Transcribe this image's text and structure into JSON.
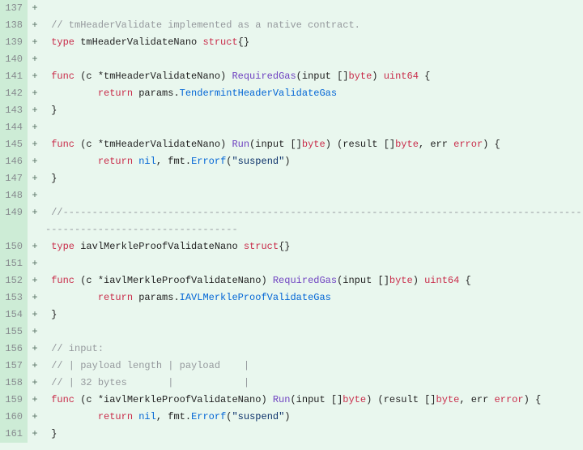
{
  "diff": {
    "lines": [
      {
        "n": "137",
        "s": "+",
        "tokens": []
      },
      {
        "n": "138",
        "s": "+",
        "tokens": [
          {
            "t": " ",
            "c": null
          },
          {
            "t": "// tmHeaderValidate implemented as a native contract.",
            "c": "cm"
          }
        ]
      },
      {
        "n": "139",
        "s": "+",
        "tokens": [
          {
            "t": " ",
            "c": null
          },
          {
            "t": "type",
            "c": "kw"
          },
          {
            "t": " tmHeaderValidateNano ",
            "c": null
          },
          {
            "t": "struct",
            "c": "kw"
          },
          {
            "t": "{}",
            "c": null
          }
        ]
      },
      {
        "n": "140",
        "s": "+",
        "tokens": []
      },
      {
        "n": "141",
        "s": "+",
        "tokens": [
          {
            "t": " ",
            "c": null
          },
          {
            "t": "func",
            "c": "kw"
          },
          {
            "t": " (c *tmHeaderValidateNano) ",
            "c": null
          },
          {
            "t": "RequiredGas",
            "c": "fn"
          },
          {
            "t": "(input []",
            "c": null
          },
          {
            "t": "byte",
            "c": "ty"
          },
          {
            "t": ") ",
            "c": null
          },
          {
            "t": "uint64",
            "c": "ty"
          },
          {
            "t": " {",
            "c": null
          }
        ]
      },
      {
        "n": "142",
        "s": "+",
        "tokens": [
          {
            "t": "         ",
            "c": null
          },
          {
            "t": "return",
            "c": "kw"
          },
          {
            "t": " params.",
            "c": null
          },
          {
            "t": "TendermintHeaderValidateGas",
            "c": "cl"
          }
        ]
      },
      {
        "n": "143",
        "s": "+",
        "tokens": [
          {
            "t": " }",
            "c": null
          }
        ]
      },
      {
        "n": "144",
        "s": "+",
        "tokens": []
      },
      {
        "n": "145",
        "s": "+",
        "tokens": [
          {
            "t": " ",
            "c": null
          },
          {
            "t": "func",
            "c": "kw"
          },
          {
            "t": " (c *tmHeaderValidateNano) ",
            "c": null
          },
          {
            "t": "Run",
            "c": "fn"
          },
          {
            "t": "(input []",
            "c": null
          },
          {
            "t": "byte",
            "c": "ty"
          },
          {
            "t": ") (result []",
            "c": null
          },
          {
            "t": "byte",
            "c": "ty"
          },
          {
            "t": ", err ",
            "c": null
          },
          {
            "t": "error",
            "c": "ty"
          },
          {
            "t": ") {",
            "c": null
          }
        ]
      },
      {
        "n": "146",
        "s": "+",
        "tokens": [
          {
            "t": "         ",
            "c": null
          },
          {
            "t": "return",
            "c": "kw"
          },
          {
            "t": " ",
            "c": null
          },
          {
            "t": "nil",
            "c": "lit"
          },
          {
            "t": ", fmt.",
            "c": null
          },
          {
            "t": "Errorf",
            "c": "cl"
          },
          {
            "t": "(",
            "c": null
          },
          {
            "t": "\"suspend\"",
            "c": "str"
          },
          {
            "t": ")",
            "c": null
          }
        ]
      },
      {
        "n": "147",
        "s": "+",
        "tokens": [
          {
            "t": " }",
            "c": null
          }
        ]
      },
      {
        "n": "148",
        "s": "+",
        "tokens": []
      },
      {
        "n": "149",
        "s": "+",
        "tokens": [
          {
            "t": " ",
            "c": null
          },
          {
            "t": "//--------------------------------------------------------------------------------------------------------------------------",
            "c": "cm"
          }
        ]
      },
      {
        "n": "150",
        "s": "+",
        "tokens": [
          {
            "t": " ",
            "c": null
          },
          {
            "t": "type",
            "c": "kw"
          },
          {
            "t": " iavlMerkleProofValidateNano ",
            "c": null
          },
          {
            "t": "struct",
            "c": "kw"
          },
          {
            "t": "{}",
            "c": null
          }
        ]
      },
      {
        "n": "151",
        "s": "+",
        "tokens": []
      },
      {
        "n": "152",
        "s": "+",
        "tokens": [
          {
            "t": " ",
            "c": null
          },
          {
            "t": "func",
            "c": "kw"
          },
          {
            "t": " (c *iavlMerkleProofValidateNano) ",
            "c": null
          },
          {
            "t": "RequiredGas",
            "c": "fn"
          },
          {
            "t": "(input []",
            "c": null
          },
          {
            "t": "byte",
            "c": "ty"
          },
          {
            "t": ") ",
            "c": null
          },
          {
            "t": "uint64",
            "c": "ty"
          },
          {
            "t": " {",
            "c": null
          }
        ]
      },
      {
        "n": "153",
        "s": "+",
        "tokens": [
          {
            "t": "         ",
            "c": null
          },
          {
            "t": "return",
            "c": "kw"
          },
          {
            "t": " params.",
            "c": null
          },
          {
            "t": "IAVLMerkleProofValidateGas",
            "c": "cl"
          }
        ]
      },
      {
        "n": "154",
        "s": "+",
        "tokens": [
          {
            "t": " }",
            "c": null
          }
        ]
      },
      {
        "n": "155",
        "s": "+",
        "tokens": []
      },
      {
        "n": "156",
        "s": "+",
        "tokens": [
          {
            "t": " ",
            "c": null
          },
          {
            "t": "// input:",
            "c": "cm"
          }
        ]
      },
      {
        "n": "157",
        "s": "+",
        "tokens": [
          {
            "t": " ",
            "c": null
          },
          {
            "t": "// | payload length | payload    |",
            "c": "cm"
          }
        ]
      },
      {
        "n": "158",
        "s": "+",
        "tokens": [
          {
            "t": " ",
            "c": null
          },
          {
            "t": "// | 32 bytes       |            |",
            "c": "cm"
          }
        ]
      },
      {
        "n": "159",
        "s": "+",
        "tokens": [
          {
            "t": " ",
            "c": null
          },
          {
            "t": "func",
            "c": "kw"
          },
          {
            "t": " (c *iavlMerkleProofValidateNano) ",
            "c": null
          },
          {
            "t": "Run",
            "c": "fn"
          },
          {
            "t": "(input []",
            "c": null
          },
          {
            "t": "byte",
            "c": "ty"
          },
          {
            "t": ") (result []",
            "c": null
          },
          {
            "t": "byte",
            "c": "ty"
          },
          {
            "t": ", err ",
            "c": null
          },
          {
            "t": "error",
            "c": "ty"
          },
          {
            "t": ") {",
            "c": null
          }
        ]
      },
      {
        "n": "160",
        "s": "+",
        "tokens": [
          {
            "t": "         ",
            "c": null
          },
          {
            "t": "return",
            "c": "kw"
          },
          {
            "t": " ",
            "c": null
          },
          {
            "t": "nil",
            "c": "lit"
          },
          {
            "t": ", fmt.",
            "c": null
          },
          {
            "t": "Errorf",
            "c": "cl"
          },
          {
            "t": "(",
            "c": null
          },
          {
            "t": "\"suspend\"",
            "c": "str"
          },
          {
            "t": ")",
            "c": null
          }
        ]
      },
      {
        "n": "161",
        "s": "+",
        "tokens": [
          {
            "t": " }",
            "c": null
          }
        ]
      }
    ]
  }
}
